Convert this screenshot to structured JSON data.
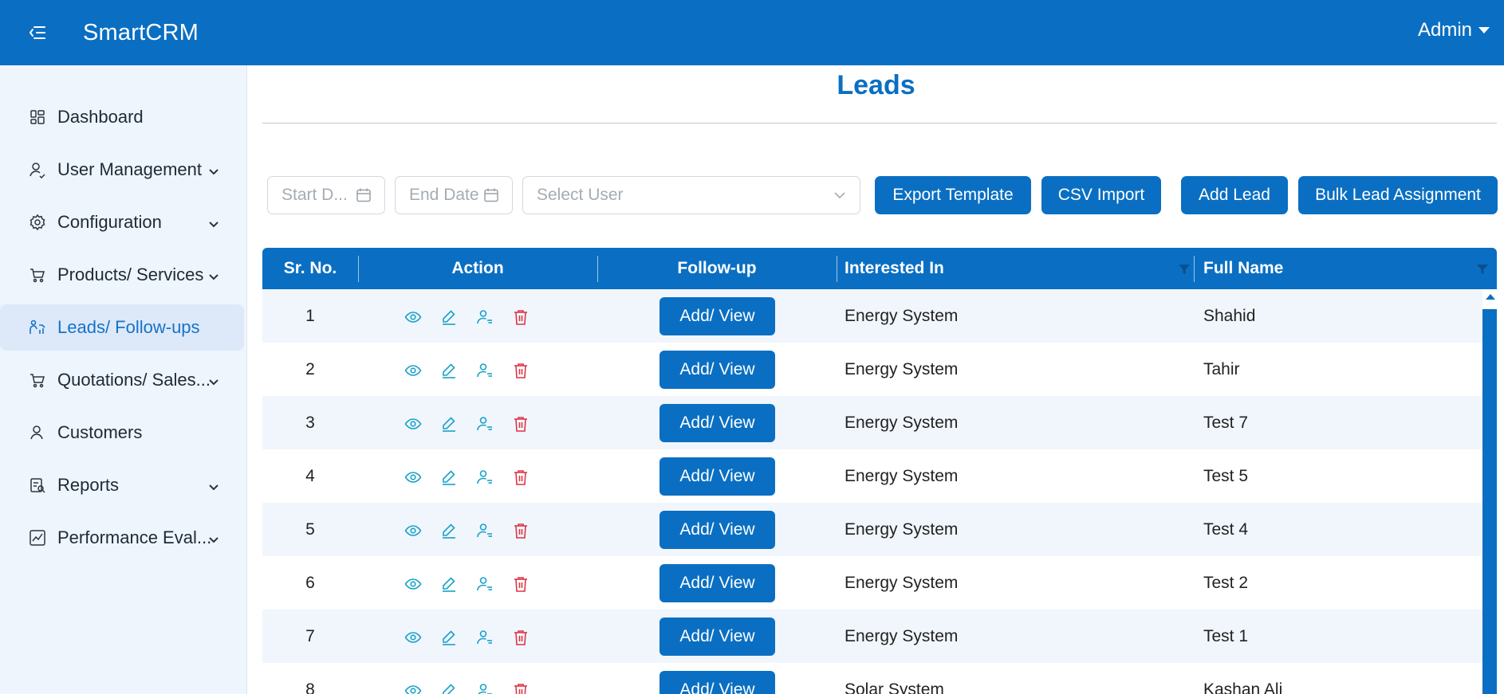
{
  "app": {
    "title": "SmartCRM",
    "user": "Admin"
  },
  "sidebar": {
    "items": [
      {
        "label": "Dashboard",
        "icon": "dashboard-icon"
      },
      {
        "label": "User Management",
        "icon": "users-icon"
      },
      {
        "label": "Configuration",
        "icon": "gear-icon"
      },
      {
        "label": "Products/ Services",
        "icon": "cart-icon"
      },
      {
        "label": "Leads/ Follow-ups",
        "icon": "leads-icon"
      },
      {
        "label": "Quotations/ Sales...",
        "icon": "cart-icon"
      },
      {
        "label": "Customers",
        "icon": "user-icon"
      },
      {
        "label": "Reports",
        "icon": "report-icon"
      },
      {
        "label": "Performance Eval...",
        "icon": "performance-icon"
      }
    ]
  },
  "page": {
    "title": "Leads"
  },
  "filters": {
    "start_date_placeholder": "Start D...",
    "end_date_placeholder": "End Date",
    "user_placeholder": "Select User"
  },
  "toolbar": {
    "export_template": "Export Template",
    "csv_import": "CSV Import",
    "add_lead": "Add Lead",
    "bulk_assign": "Bulk Lead Assignment"
  },
  "table": {
    "headers": {
      "sr": "Sr. No.",
      "action": "Action",
      "followup": "Follow-up",
      "interested": "Interested In",
      "name": "Full Name"
    },
    "followup_button": "Add/ View",
    "rows": [
      {
        "sr": "1",
        "interested": "Energy System",
        "name": "Shahid"
      },
      {
        "sr": "2",
        "interested": "Energy System",
        "name": "Tahir"
      },
      {
        "sr": "3",
        "interested": "Energy System",
        "name": "Test 7"
      },
      {
        "sr": "4",
        "interested": "Energy System",
        "name": "Test 5"
      },
      {
        "sr": "5",
        "interested": "Energy System",
        "name": "Test 4"
      },
      {
        "sr": "6",
        "interested": "Energy System",
        "name": "Test 2"
      },
      {
        "sr": "7",
        "interested": "Energy System",
        "name": "Test 1"
      },
      {
        "sr": "8",
        "interested": "Solar System",
        "name": "Kashan Ali"
      }
    ]
  },
  "colors": {
    "primary": "#0a6fc2",
    "action_icon": "#17a2c8",
    "delete_icon": "#dc3545",
    "row_stripe": "#f1f6fd",
    "sidebar_bg": "#eef5fd"
  }
}
